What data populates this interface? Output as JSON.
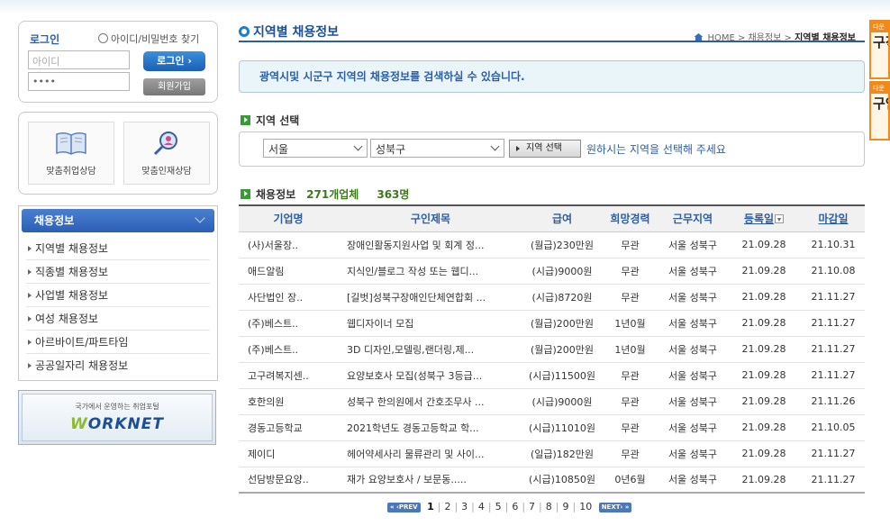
{
  "login": {
    "title": "로그인",
    "find_link": "아이디/비밀번호 찾기",
    "id_placeholder": "아이디",
    "password_value": "••••",
    "login_button": "로그인 ›",
    "join_button": "회원가입"
  },
  "counsel": {
    "job_counsel": "맞춤취업상담",
    "talent_counsel": "맞춤인재상담"
  },
  "menu": {
    "title": "채용정보",
    "items": [
      "지역별 채용정보",
      "직종별 채용정보",
      "사업별 채용정보",
      "여성 채용정보",
      "아르바이트/파트타임",
      "공공일자리 채용정보"
    ]
  },
  "worknet": {
    "subtitle": "국가에서 운영하는 취업포털",
    "logo_w": "W",
    "logo_rest": "ORKNET"
  },
  "page": {
    "title": "지역별 채용정보",
    "breadcrumb_home": "HOME",
    "breadcrumb_1": "채용정보",
    "breadcrumb_current": "지역별 채용정보",
    "info": "광역시및 시군구 지역의 채용정보를 검색하실 수 있습니다."
  },
  "region": {
    "section_title": "지역 선택",
    "city": "서울",
    "district": "성북구",
    "button": "지역 선택",
    "hint": "원하시는 지역을 선택해 주세요"
  },
  "jobs": {
    "section_title": "채용정보",
    "company_count": "271개업체",
    "person_count": "363명",
    "headers": [
      "기업명",
      "구인제목",
      "급여",
      "희망경력",
      "근무지역",
      "등록일",
      "마감일"
    ],
    "rows": [
      [
        "(사)서울장..",
        "장애인활동지원사업 및 회계 정...",
        "(월급)230만원",
        "무관",
        "서울 성북구",
        "21.09.28",
        "21.10.31"
      ],
      [
        "애드알림",
        "지식인/블로그 작성 또는 웹디...",
        "(시급)9000원",
        "무관",
        "서울 성북구",
        "21.09.28",
        "21.10.08"
      ],
      [
        "사단법인 장..",
        "[길벗]성북구장애인단체연합회 ...",
        "(시급)8720원",
        "무관",
        "서울 성북구",
        "21.09.28",
        "21.11.27"
      ],
      [
        "(주)베스트..",
        "웹디자이너 모집",
        "(월급)200만원",
        "1년0월",
        "서울 성북구",
        "21.09.28",
        "21.11.27"
      ],
      [
        "(주)베스트..",
        "3D 디자인,모델링,랜더링,제...",
        "(월급)200만원",
        "1년0월",
        "서울 성북구",
        "21.09.28",
        "21.11.27"
      ],
      [
        "고구려복지센..",
        "요양보호사 모집(성북구 3등급...",
        "(시급)11500원",
        "무관",
        "서울 성북구",
        "21.09.28",
        "21.11.27"
      ],
      [
        "호한의원",
        "성북구 한의원에서 간호조무사 ...",
        "(시급)9000원",
        "무관",
        "서울 성북구",
        "21.09.28",
        "21.11.26"
      ],
      [
        "경동고등학교",
        "2021학년도 경동고등학교 학...",
        "(시급)11010원",
        "무관",
        "서울 성북구",
        "21.09.28",
        "21.10.05"
      ],
      [
        "제이디",
        "헤어약세사리 물류관리 및 사이...",
        "(일급)182만원",
        "무관",
        "서울 성북구",
        "21.09.28",
        "21.11.27"
      ],
      [
        "선담방문요양..",
        "재가 요양보호사 / 보문동.....",
        "(시급)10850원",
        "0년6월",
        "서울 성북구",
        "21.09.28",
        "21.11.27"
      ]
    ]
  },
  "pager": {
    "prev": "« ‹PREV",
    "next": "NEXT› »",
    "pages": [
      "1",
      "2",
      "3",
      "4",
      "5",
      "6",
      "7",
      "8",
      "9",
      "10"
    ]
  },
  "banners": [
    {
      "top": "다운",
      "big": "구직"
    },
    {
      "top": "다운",
      "big": "구인"
    }
  ]
}
